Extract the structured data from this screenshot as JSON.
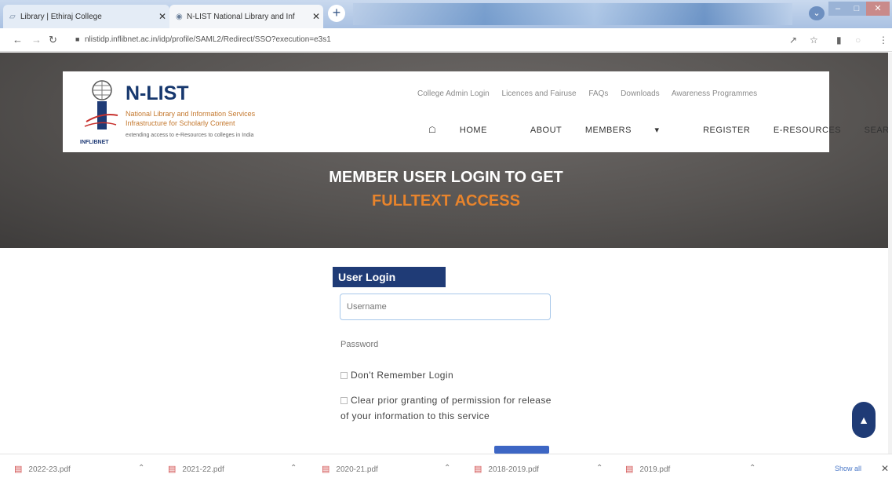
{
  "browser": {
    "tabs": [
      {
        "label": "Library | Ethiraj College"
      },
      {
        "label": "N-LIST National Library and Inf"
      }
    ],
    "url": "nlistidp.inflibnet.ac.in/idp/profile/SAML2/Redirect/SSO?execution=e3s1"
  },
  "site": {
    "brand": "N-LIST",
    "brand_sub1": "National Library and Information Services",
    "brand_sub2": "Infrastructure for Scholarly Content",
    "brand_tagline": "extending access to e-Resources to colleges in India",
    "logo_caption": "INFLIBNET",
    "top_links": [
      "College Admin Login",
      "Licences and Fairuse",
      "FAQs",
      "Downloads",
      "Awareness Programmes"
    ],
    "menu": {
      "home": "HOME",
      "about": "ABOUT",
      "members": "MEMBERS",
      "register": "REGISTER",
      "eresources": "E-RESOURCES",
      "search": "SEARCH"
    },
    "hero_title": "MEMBER USER LOGIN TO GET",
    "hero_sub": "FULLTEXT ACCESS"
  },
  "login": {
    "header": "User Login",
    "username_placeholder": "Username",
    "password_placeholder": "Password",
    "remember_label": "Don't Remember Login",
    "clear_label": "Clear prior granting of permission for release of your information to this service"
  },
  "downloads": {
    "files": [
      "2022-23.pdf",
      "2021-22.pdf",
      "2020-21.pdf",
      "2018-2019.pdf",
      "2019.pdf"
    ],
    "show_all": "Show all"
  },
  "colors": {
    "brand_navy": "#1f3b76",
    "accent_orange": "#e8842c"
  }
}
